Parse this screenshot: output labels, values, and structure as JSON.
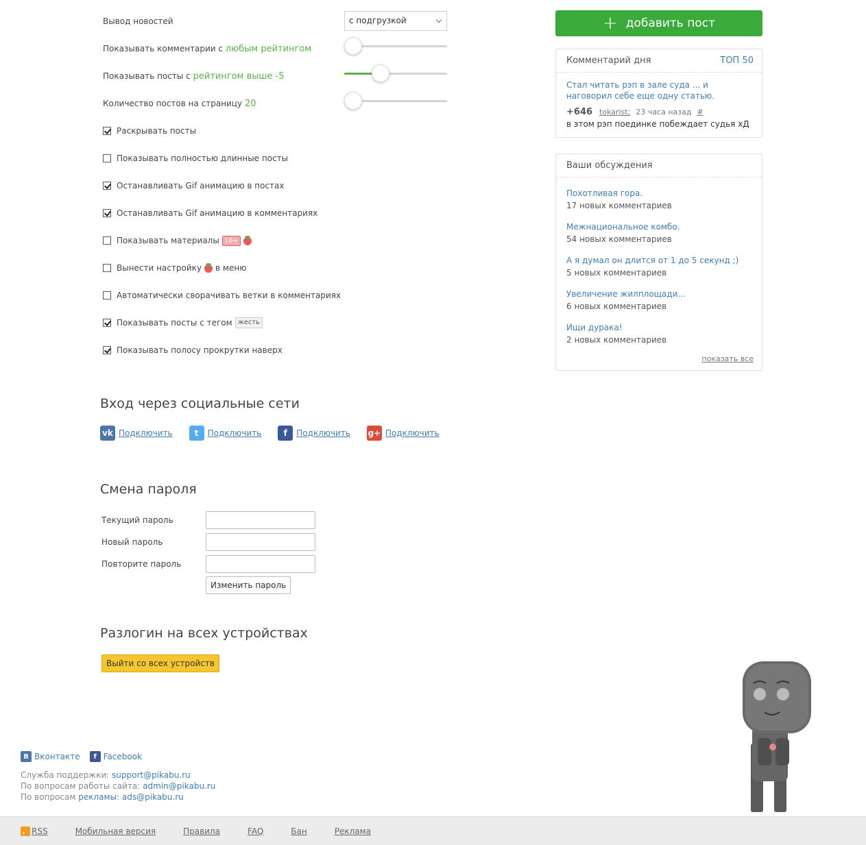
{
  "settings": {
    "news_output_label": "Вывод новостей",
    "news_output_value": "с подгрузкой",
    "comments_label": "Показывать комментарии с",
    "comments_value": "любым рейтингом",
    "comments_slider": 0,
    "posts_label": "Показывать посты с",
    "posts_value": "рейтингом выше -5",
    "posts_slider": 0.35,
    "per_page_label": "Количество постов на страницу",
    "per_page_value": "20",
    "per_page_slider": 0,
    "checkboxes": [
      {
        "label": "Раскрывать посты",
        "checked": true
      },
      {
        "label": "Показывать полностью длинные посты",
        "checked": false
      },
      {
        "label": "Останавливать Gif анимацию в постах",
        "checked": true
      },
      {
        "label": "Останавливать Gif анимацию в комментариях",
        "checked": true
      },
      {
        "label": "Показывать материалы",
        "checked": false,
        "badge": "16+"
      },
      {
        "label": "Вынести настройку",
        "checked": false,
        "suffix": "в меню"
      },
      {
        "label": "Автоматически сворачивать ветки в комментариях",
        "checked": false
      },
      {
        "label": "Показывать посты с тегом",
        "checked": true,
        "tag": "жесть"
      },
      {
        "label": "Показывать полосу прокрутки наверх",
        "checked": true
      }
    ]
  },
  "social_login": {
    "heading": "Вход через социальные сети",
    "items": [
      {
        "icon": "vk-icon",
        "glyph": "vk",
        "color": "#4a76a8",
        "label": "Подключить"
      },
      {
        "icon": "twitter-icon",
        "glyph": "t",
        "color": "#55acee",
        "label": "Подключить"
      },
      {
        "icon": "facebook-icon",
        "glyph": "f",
        "color": "#3b5998",
        "label": "Подключить"
      },
      {
        "icon": "google-plus-icon",
        "glyph": "g+",
        "color": "#dd4b39",
        "label": "Подключить"
      }
    ]
  },
  "password": {
    "heading": "Смена пароля",
    "current_label": "Текущий пароль",
    "new_label": "Новый пароль",
    "repeat_label": "Повторите пароль",
    "submit_label": "Изменить пароль"
  },
  "logout": {
    "heading": "Разлогин на всех устройствах",
    "button_label": "Выйти со всех устройств"
  },
  "sidebar": {
    "add_post_label": "добавить пост",
    "comment_of_day": {
      "title": "Комментарий дня",
      "top_link": "ТОП 50",
      "post_title": "Стал читать рэп в зале суда ... и наговорил себе еще одну статью.",
      "rating": "+646",
      "author": "tokarist;",
      "time": "23 часа назад",
      "hash": "#",
      "text": "в этом рэп поединке побеждает судья хД"
    },
    "discussions": {
      "title": "Ваши обсуждения",
      "items": [
        {
          "title": "Похотливая гора.",
          "count": "17 новых комментариев"
        },
        {
          "title": "Межнациональное комбо.",
          "count": "54 новых комментариев"
        },
        {
          "title": "А я думал он длится от 1 до 5 секунд ;)",
          "count": "5 новых комментариев"
        },
        {
          "title": "Увеличение жилплощади...",
          "count": "6 новых комментариев"
        },
        {
          "title": "Ищи дурака!",
          "count": "2 новых комментариев"
        }
      ],
      "show_all": "показать все"
    }
  },
  "footer": {
    "vk_label": "Вконтакте",
    "fb_label": "Facebook",
    "support_prefix": "Служба поддержки:",
    "support_email": "support@pikabu.ru",
    "admin_prefix": "По вопросам работы сайта:",
    "admin_email": "admin@pikabu.ru",
    "ads_prefix": "По вопросам",
    "ads_link": "рекламы",
    "ads_email": "ads@pikabu.ru",
    "links": [
      "RSS",
      "Мобильная версия",
      "Правила",
      "FAQ",
      "Бан",
      "Реклама"
    ]
  },
  "colors": {
    "accent_green": "#3aaa3a",
    "link_blue": "#3f7eb6",
    "rating_green": "#5bb346",
    "logout_yellow": "#f6c62e"
  }
}
